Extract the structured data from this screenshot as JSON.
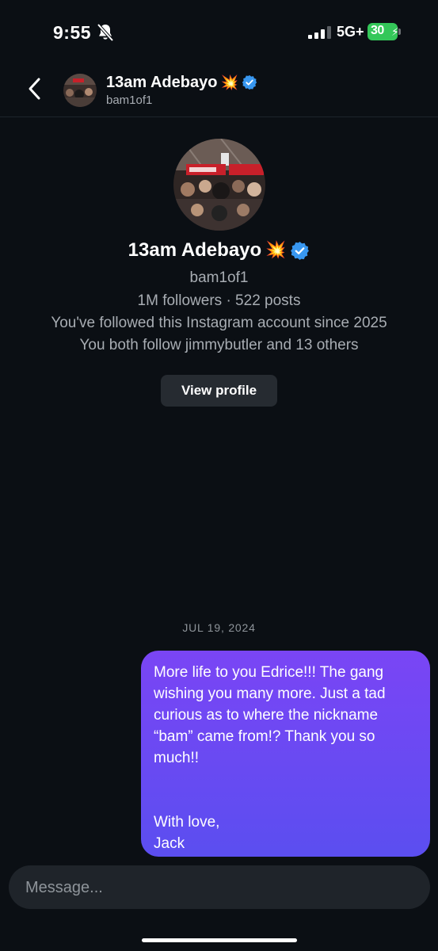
{
  "status_bar": {
    "time": "9:55",
    "network": "5G+",
    "battery": "30",
    "icons": [
      "bell-slash-icon",
      "signal-icon",
      "battery-icon"
    ]
  },
  "header": {
    "name": "13am Adebayo",
    "name_emoji": "💥",
    "handle": "bam1of1",
    "icons": [
      "chevron-left-icon",
      "verified-badge-icon"
    ]
  },
  "profile": {
    "name": "13am Adebayo",
    "name_emoji": "💥",
    "handle": "bam1of1",
    "stats": "1M followers · 522 posts",
    "follow_since": "You've followed this Instagram account since 2025",
    "mutual": "You both follow jimmybutler and 13 others",
    "view_profile_label": "View profile"
  },
  "conversation": {
    "date": "JUL 19, 2024",
    "messages": [
      {
        "sender": "me",
        "text": "More life to you Edrice!!! The gang wishing you many more. Just a tad curious as to where the nickname “bam” came from!? Thank you so much!!\n\n\nWith love,\nJack"
      }
    ]
  },
  "composer": {
    "placeholder": "Message..."
  },
  "colors": {
    "background": "#0b0f14",
    "bubble_top": "#7a45f5",
    "bubble_bottom": "#5b4ef0",
    "verified": "#3897f0",
    "battery": "#34c759",
    "secondary_text": "#a8adb3"
  }
}
